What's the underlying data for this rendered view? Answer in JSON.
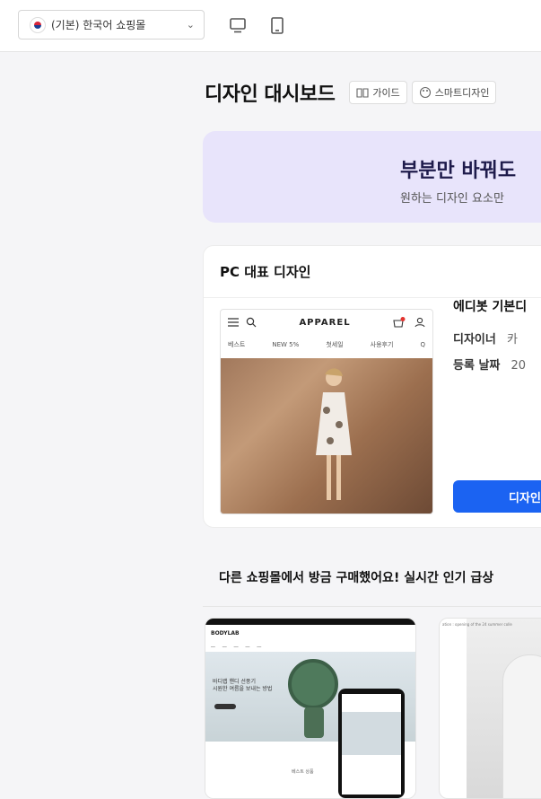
{
  "topbar": {
    "mall_select": "(기본) 한국어 쇼핑몰",
    "icons": [
      "korea-flag-icon",
      "chevron-down-icon",
      "desktop-icon",
      "mobile-icon"
    ]
  },
  "header": {
    "title": "디자인 대시보드",
    "guide_label": "가이드",
    "smart_label": "스마트디자인"
  },
  "banner": {
    "title": "부분만 바꿔도",
    "subtitle": "원하는 디자인 요소만"
  },
  "pc_design": {
    "section_title": "PC 대표 디자인",
    "preview": {
      "logo": "APPAREL",
      "menu": [
        "베스트",
        "NEW 5%",
        "첫세일",
        "사용후기",
        "Q"
      ]
    },
    "name": "에디봇 기본디",
    "designer_label": "디자이너",
    "designer_value": "카",
    "date_label": "등록 날짜",
    "date_value": "20",
    "button": "디자인"
  },
  "popular": {
    "title": "다른 쇼핑몰에서 방금 구매했어요! 실시간 인기 급상",
    "item1": {
      "logo": "BODYLAB",
      "hero_line1": "바디랩 핸디 선풍기",
      "hero_line2": "시원한 여름을 보내는 방법",
      "section": "베스트 상품"
    },
    "item2": {
      "caption": "ation : opening of the 24 summer colle"
    }
  },
  "colors": {
    "accent": "#1b63f2",
    "banner_bg": "#e8e4fb",
    "page_bg": "#f5f5f7"
  }
}
